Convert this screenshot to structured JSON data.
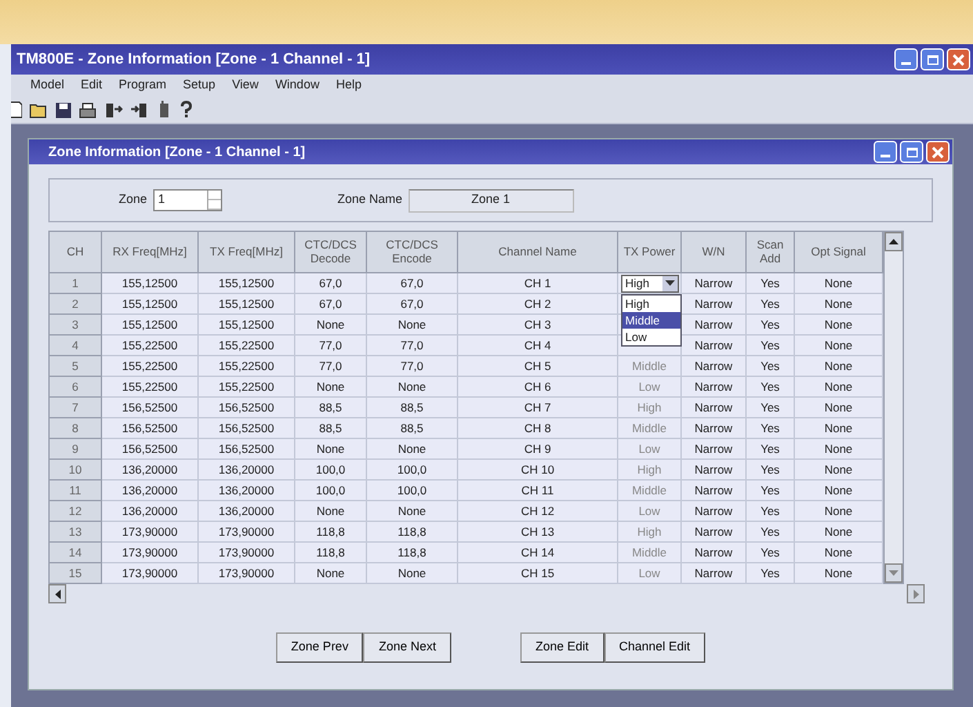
{
  "window": {
    "title": "TM800E - Zone Information [Zone - 1  Channel - 1]"
  },
  "menu": {
    "items": [
      "Model",
      "Edit",
      "Program",
      "Setup",
      "View",
      "Window",
      "Help"
    ]
  },
  "child_window": {
    "title": "Zone Information [Zone - 1  Channel - 1]"
  },
  "zone": {
    "label": "Zone",
    "value": "1"
  },
  "zone_name": {
    "label": "Zone Name",
    "value": "Zone  1"
  },
  "table": {
    "columns": [
      "CH",
      "RX Freq[MHz]",
      "TX Freq[MHz]",
      "CTC/DCS Decode",
      "CTC/DCS Encode",
      "Channel Name",
      "TX Power",
      "W/N",
      "Scan Add",
      "Opt Signal"
    ],
    "rows": [
      {
        "ch": "1",
        "rx": "155,12500",
        "tx": "155,12500",
        "decode": "67,0",
        "encode": "67,0",
        "name": "CH  1",
        "power": "High",
        "win": "Narrow",
        "scan": "Yes",
        "opt": "None",
        "editor": {
          "expanded": true,
          "options": [
            {
              "label": "High",
              "selected": false
            },
            {
              "label": "Middle",
              "selected": true
            },
            {
              "label": "Low",
              "selected": false
            }
          ]
        }
      },
      {
        "ch": "2",
        "rx": "155,12500",
        "tx": "155,12500",
        "decode": "67,0",
        "encode": "67,0",
        "name": "CH  2",
        "win": "Narrow",
        "scan": "Yes",
        "opt": "None"
      },
      {
        "ch": "3",
        "rx": "155,12500",
        "tx": "155,12500",
        "decode": "None",
        "encode": "None",
        "name": "CH  3",
        "win": "Narrow",
        "scan": "Yes",
        "opt": "None"
      },
      {
        "ch": "4",
        "rx": "155,22500",
        "tx": "155,22500",
        "decode": "77,0",
        "encode": "77,0",
        "name": "CH  4",
        "win": "Narrow",
        "scan": "Yes",
        "opt": "None"
      },
      {
        "ch": "5",
        "rx": "155,22500",
        "tx": "155,22500",
        "decode": "77,0",
        "encode": "77,0",
        "name": "CH  5",
        "power": "Middle",
        "win": "Narrow",
        "scan": "Yes",
        "opt": "None"
      },
      {
        "ch": "6",
        "rx": "155,22500",
        "tx": "155,22500",
        "decode": "None",
        "encode": "None",
        "name": "CH  6",
        "power": "Low",
        "win": "Narrow",
        "scan": "Yes",
        "opt": "None"
      },
      {
        "ch": "7",
        "rx": "156,52500",
        "tx": "156,52500",
        "decode": "88,5",
        "encode": "88,5",
        "name": "CH  7",
        "power": "High",
        "win": "Narrow",
        "scan": "Yes",
        "opt": "None"
      },
      {
        "ch": "8",
        "rx": "156,52500",
        "tx": "156,52500",
        "decode": "88,5",
        "encode": "88,5",
        "name": "CH  8",
        "power": "Middle",
        "win": "Narrow",
        "scan": "Yes",
        "opt": "None"
      },
      {
        "ch": "9",
        "rx": "156,52500",
        "tx": "156,52500",
        "decode": "None",
        "encode": "None",
        "name": "CH 9",
        "power": "Low",
        "win": "Narrow",
        "scan": "Yes",
        "opt": "None"
      },
      {
        "ch": "10",
        "rx": "136,20000",
        "tx": "136,20000",
        "decode": "100,0",
        "encode": "100,0",
        "name": "CH 10",
        "power": "High",
        "win": "Narrow",
        "scan": "Yes",
        "opt": "None"
      },
      {
        "ch": "11",
        "rx": "136,20000",
        "tx": "136,20000",
        "decode": "100,0",
        "encode": "100,0",
        "name": "CH 11",
        "power": "Middle",
        "win": "Narrow",
        "scan": "Yes",
        "opt": "None"
      },
      {
        "ch": "12",
        "rx": "136,20000",
        "tx": "136,20000",
        "decode": "None",
        "encode": "None",
        "name": "CH 12",
        "power": "Low",
        "win": "Narrow",
        "scan": "Yes",
        "opt": "None"
      },
      {
        "ch": "13",
        "rx": "173,90000",
        "tx": "173,90000",
        "decode": "118,8",
        "encode": "118,8",
        "name": "CH 13",
        "power": "High",
        "win": "Narrow",
        "scan": "Yes",
        "opt": "None"
      },
      {
        "ch": "14",
        "rx": "173,90000",
        "tx": "173,90000",
        "decode": "118,8",
        "encode": "118,8",
        "name": "CH 14",
        "power": "Middle",
        "win": "Narrow",
        "scan": "Yes",
        "opt": "None"
      },
      {
        "ch": "15",
        "rx": "173,90000",
        "tx": "173,90000",
        "decode": "None",
        "encode": "None",
        "name": "CH 15",
        "power": "Low",
        "win": "Narrow",
        "scan": "Yes",
        "opt": "None"
      }
    ]
  },
  "buttons": [
    "Zone Prev",
    "Zone Next",
    "Zone Edit",
    "Channel Edit"
  ]
}
